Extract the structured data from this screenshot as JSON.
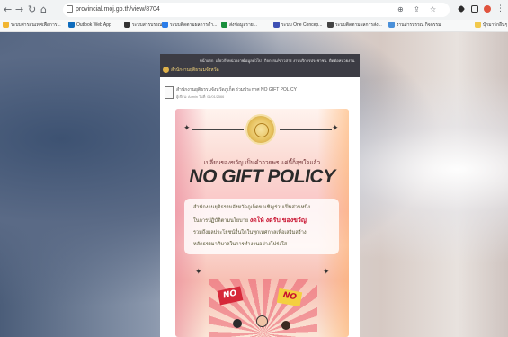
{
  "browser": {
    "url": "provincial.moj.go.th/view/8704",
    "icons": [
      "back-icon",
      "forward-icon",
      "reload-icon",
      "home-icon",
      "zoom-icon",
      "share-icon",
      "star-icon",
      "extensions-icon",
      "sidebar-icon",
      "profile-icon"
    ]
  },
  "bookmarks": {
    "items": [
      {
        "label": "ระบบสารสนเทศเพื่อการ...",
        "color": "#f2b632"
      },
      {
        "label": "Outlook Web App",
        "color": "#0f6cbd"
      },
      {
        "label": "ระบบสารบรรณ",
        "color": "#333333"
      },
      {
        "label": "ระบบติดตามผลการดำ...",
        "color": "#2b7de9"
      },
      {
        "label": "ส่งข้อมูลราย...",
        "color": "#1a8f3c"
      },
      {
        "label": "ระบบ One Concep...",
        "color": "#3f51b5"
      },
      {
        "label": "ระบบติดตามผลการส่ง...",
        "color": "#444444"
      },
      {
        "label": "งานสารบรรณ กิจกรรม",
        "color": "#4a90d9"
      }
    ],
    "right_label": "บุ๊กมาร์กอื่นๆ"
  },
  "site": {
    "logo_text": "สำนักงานยุติธรรมจังหวัด",
    "nav": [
      "หน้าแรก",
      "เกี่ยวกับหน่วยงาน",
      "ข้อมูลทั่วไป",
      "กิจกรรม/ข่าวสาร",
      "งานบริการประชาชน",
      "ติดต่อหน่วยงาน"
    ]
  },
  "post": {
    "title": "สำนักงานยุติธรรมจังหวัดภูเก็ต ร่วมประกาศ NO GIFT POLICY",
    "meta": "ผู้เขียน: Admin   วันที่: 01/01/2566"
  },
  "poster": {
    "subtitle": "เปลี่ยนของขวัญ เป็นคำอวยพร แค่นี้ก็สุขใจแล้ว",
    "headline": "NO GIFT POLICY",
    "line1": "สำนักงานยุติธรรมจังหวัดภูเก็ตขอเชิญร่วมเป็นส่วนหนึ่ง",
    "line2_pre": "ในการปฏิบัติตามนโยบาย",
    "line2_hl": "งดให้ งดรับ ของขวัญ",
    "line3": "รวมถึงผลประโยชน์อื่นใดในทุกเทศกาลเพื่อเสริมสร้าง",
    "line4": "หลักธรรมาภิบาลในการทำงานอย่างโปร่งใส",
    "sign1": "NO",
    "sign2": "NO",
    "colors": {
      "accent": "#c8102e",
      "sign_red": "#d62839",
      "sign_yellow": "#f4d03f"
    }
  }
}
